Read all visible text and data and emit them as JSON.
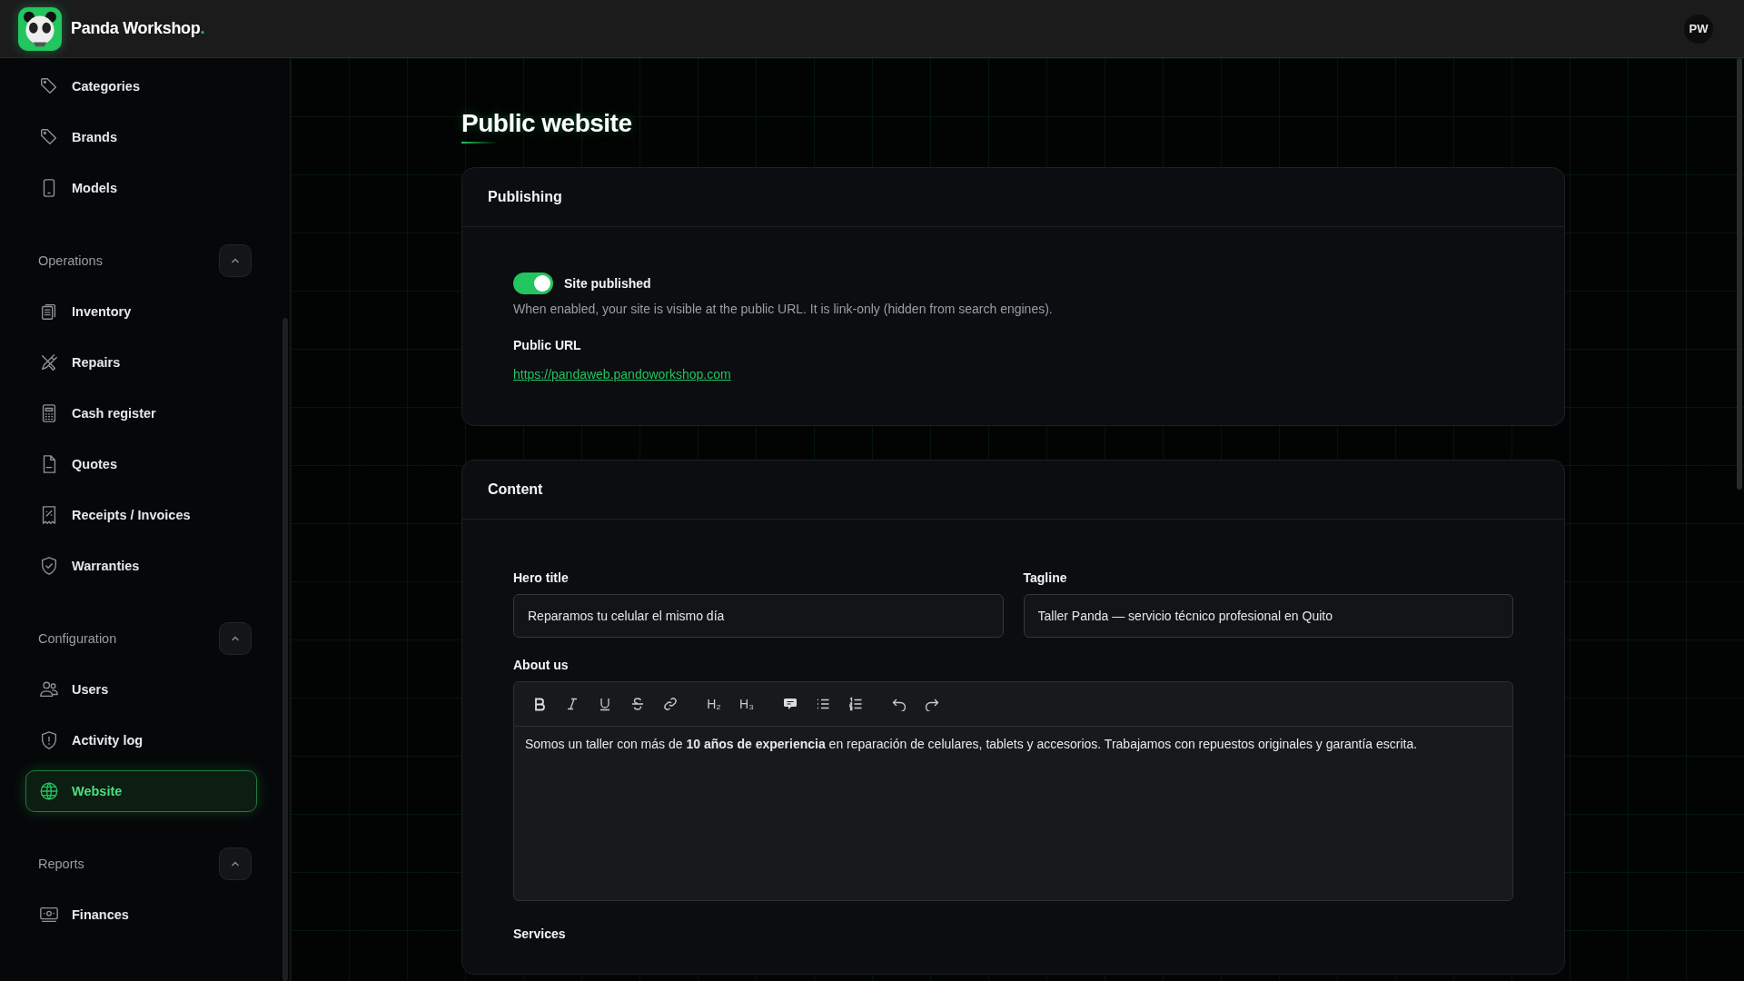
{
  "header": {
    "brand": "Panda Workshop",
    "brand_dot": ".",
    "avatar": "PW"
  },
  "sidebar": {
    "sections": [
      {
        "items": [
          {
            "label": "Categories",
            "kind": "tag",
            "selected": false
          },
          {
            "label": "Brands",
            "kind": "tag",
            "selected": false
          },
          {
            "label": "Models",
            "kind": "phone",
            "selected": false
          }
        ]
      },
      {
        "label": "Operations",
        "expanded": true,
        "items": [
          {
            "label": "Inventory",
            "kind": "clipboard",
            "selected": false
          },
          {
            "label": "Repairs",
            "kind": "tools",
            "selected": false
          },
          {
            "label": "Cash register",
            "kind": "calculator",
            "selected": false
          },
          {
            "label": "Quotes",
            "kind": "document",
            "selected": false
          },
          {
            "label": "Receipts / Invoices",
            "kind": "receipt",
            "selected": false
          },
          {
            "label": "Warranties",
            "kind": "shield-check",
            "selected": false
          }
        ]
      },
      {
        "label": "Configuration",
        "expanded": true,
        "items": [
          {
            "label": "Users",
            "kind": "users",
            "selected": false
          },
          {
            "label": "Activity log",
            "kind": "shield-alert",
            "selected": false
          },
          {
            "label": "Website",
            "kind": "globe",
            "selected": true
          }
        ]
      },
      {
        "label": "Reports",
        "expanded": true,
        "items": [
          {
            "label": "Finances",
            "kind": "money",
            "selected": false
          }
        ]
      }
    ]
  },
  "page": {
    "title": "Public website"
  },
  "publishing": {
    "title": "Publishing",
    "toggle": {
      "label": "Site published",
      "on": true
    },
    "description": "When enabled, your site is visible at the public URL. It is link-only (hidden from search engines).",
    "url_label": "Public URL",
    "url": "https://pandaweb.pandoworkshop.com"
  },
  "content": {
    "title": "Content",
    "fields": [
      {
        "label": "Hero title",
        "value": "Reparamos tu celular el mismo día"
      },
      {
        "label": "Tagline",
        "value": "Taller Panda — servicio técnico profesional en Quito"
      }
    ],
    "about": {
      "label": "About us",
      "headings": [
        "H₂",
        "H₃"
      ],
      "text": "Somos un taller con más de **10 años de experiencia** en reparación de celulares, tablets y accesorios. Trabajamos con repuestos originales y garantía escrita."
    },
    "next_label": "Services"
  }
}
